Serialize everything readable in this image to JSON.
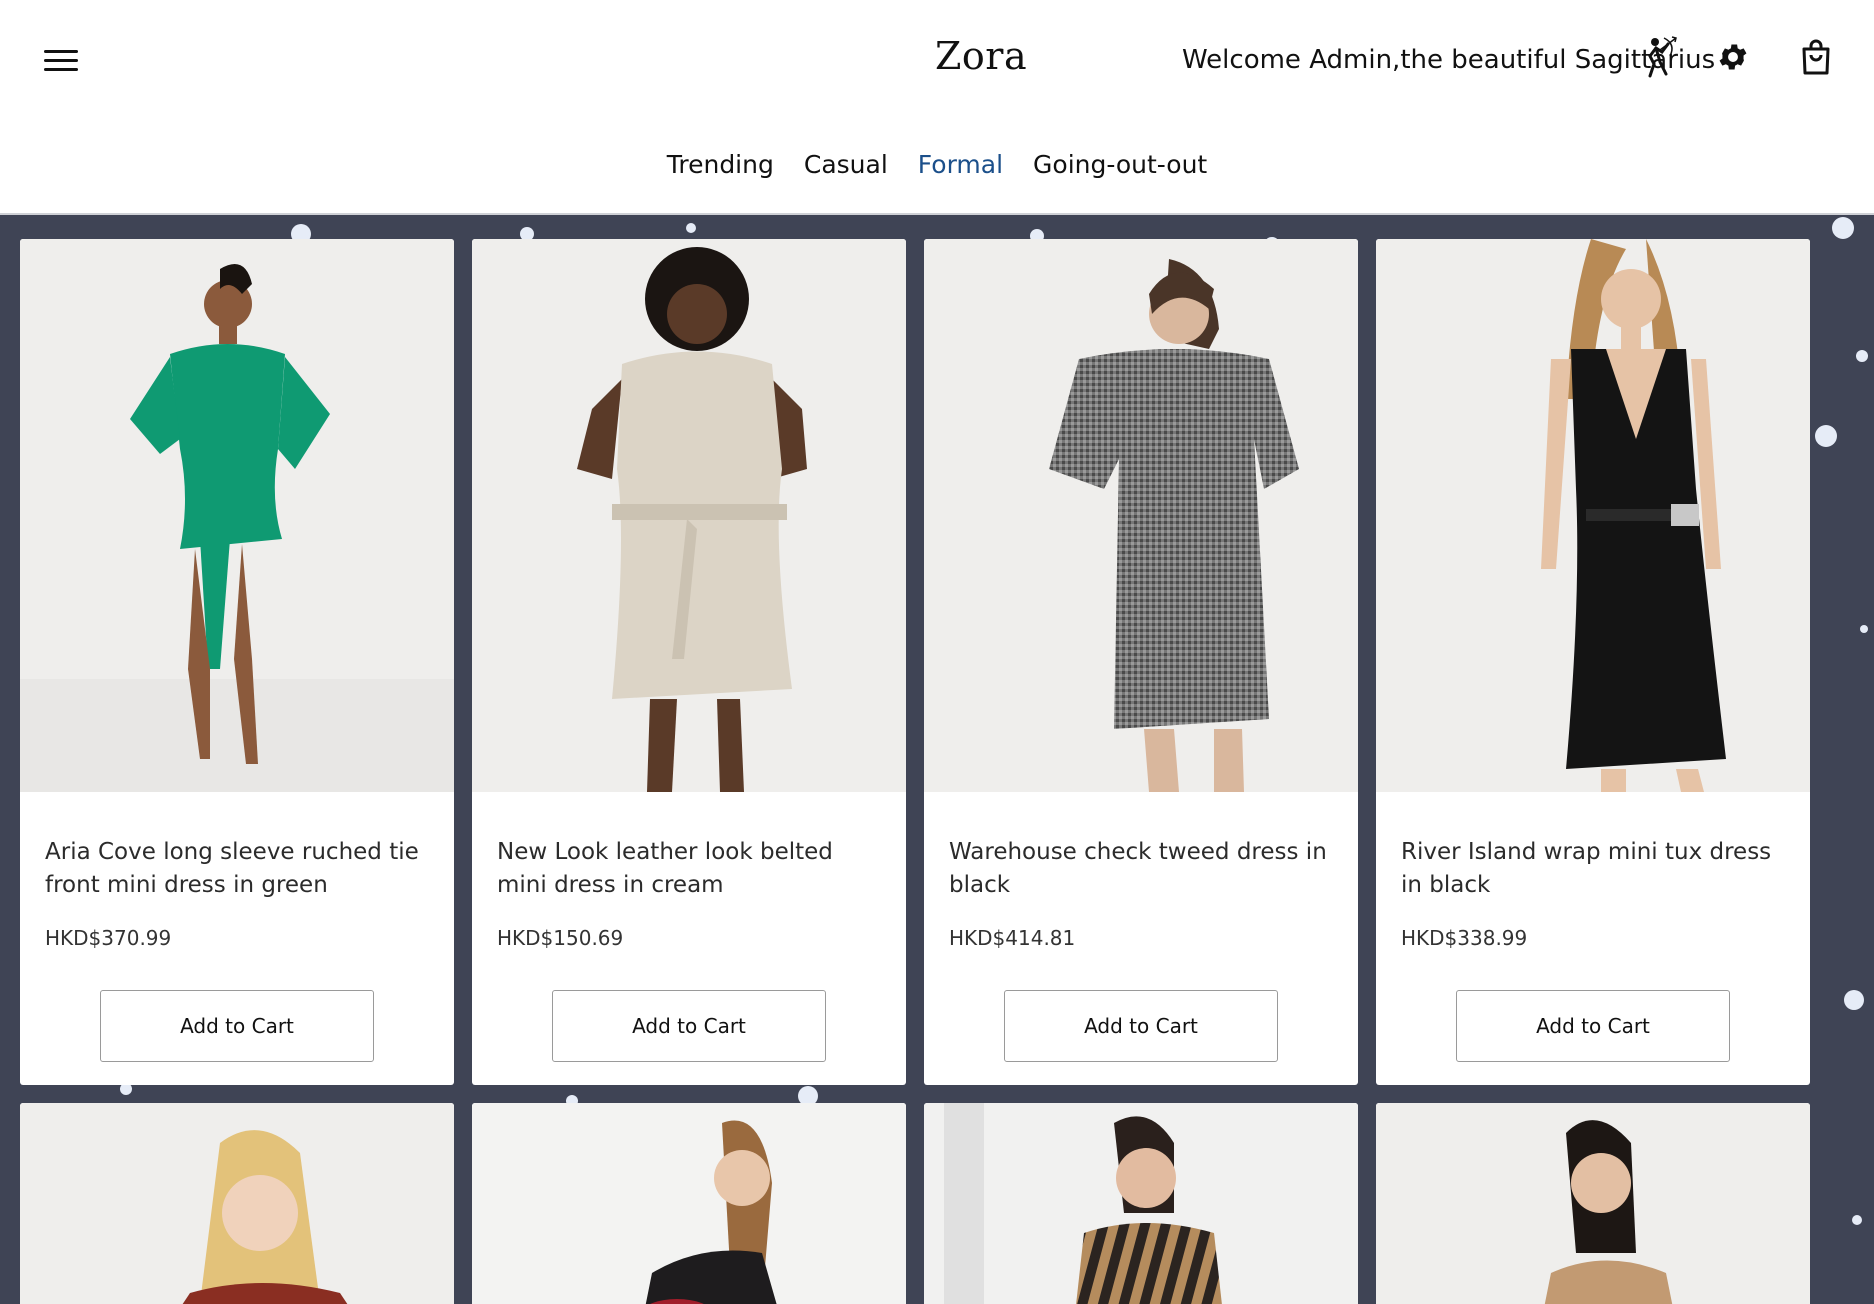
{
  "header": {
    "brand": "Zora",
    "welcome": "Welcome Admin,the beautiful Sagittarius",
    "menu_icon": "hamburger-menu-icon",
    "zodiac_icon": "sagittarius-archer-icon",
    "settings_icon": "gear-icon",
    "cart_icon": "shopping-bag-icon"
  },
  "tabs": [
    {
      "label": "Trending",
      "active": false
    },
    {
      "label": "Casual",
      "active": false
    },
    {
      "label": "Formal",
      "active": true
    },
    {
      "label": "Going-out-out",
      "active": false
    }
  ],
  "colors": {
    "active_tab": "#1b4f8a",
    "page_background": "#3f4455"
  },
  "products": [
    {
      "title": "Aria Cove long sleeve ruched tie front mini dress in green",
      "price": "HKD$370.99",
      "button": "Add to Cart",
      "dress_color": "#0f9a72"
    },
    {
      "title": "New Look leather look belted mini dress in cream",
      "price": "HKD$150.69",
      "button": "Add to Cart",
      "dress_color": "#dcd4c6"
    },
    {
      "title": "Warehouse check tweed dress in black",
      "price": "HKD$414.81",
      "button": "Add to Cart",
      "dress_color": "#6b6b6b"
    },
    {
      "title": "River Island wrap mini tux dress in black",
      "price": "HKD$338.99",
      "button": "Add to Cart",
      "dress_color": "#141414"
    }
  ],
  "more_products": [
    {
      "image": "blonde-model-red-blazer-photo"
    },
    {
      "image": "model-black-sequin-dress-photo"
    },
    {
      "image": "model-striped-shirt-dress-photo"
    },
    {
      "image": "model-camel-dress-photo"
    }
  ]
}
